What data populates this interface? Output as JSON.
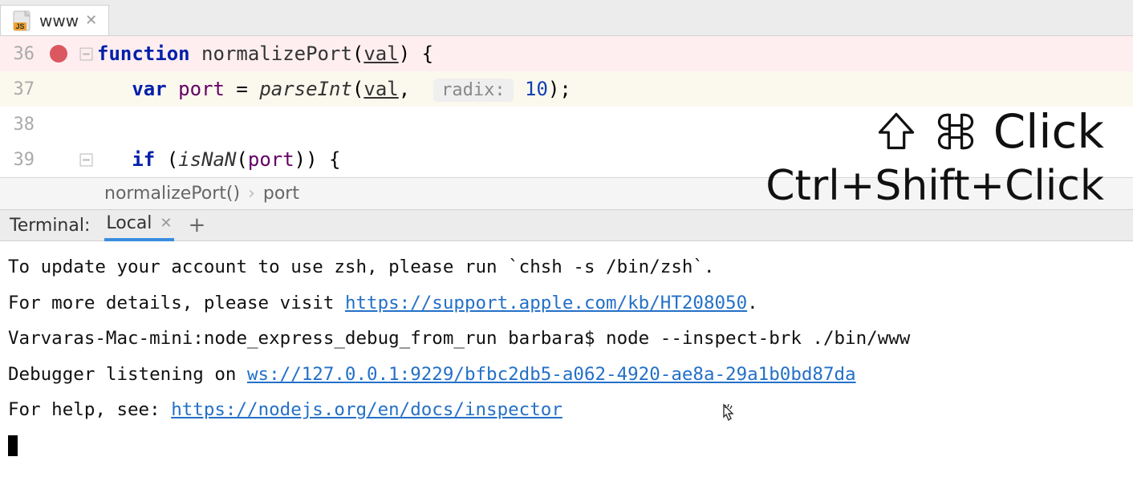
{
  "tab": {
    "filename": "www"
  },
  "code": {
    "lines": [
      36,
      37,
      38,
      39
    ],
    "l36": {
      "kw": "function",
      "fn": "normalizePort",
      "param": "val",
      "tail": ") {"
    },
    "l37": {
      "kw": "var",
      "varname": "port",
      "eq": " = ",
      "call": "parseInt",
      "open": "(",
      "param": "val",
      "comma": ",",
      "hint": "radix:",
      "num": "10",
      "tail": ");"
    },
    "l39": {
      "kw": "if",
      "open": " (",
      "call": "isNaN",
      "popen": "(",
      "var": "port",
      "tail": ")) {"
    }
  },
  "overlay": {
    "mac": "Click",
    "other": "Ctrl+Shift+Click"
  },
  "breadcrumb": {
    "fn": "normalizePort()",
    "var": "port"
  },
  "terminal": {
    "label": "Terminal:",
    "tab": "Local",
    "lines": {
      "l1a": "To update your account to use zsh, please run `chsh -s /bin/zsh`.",
      "l2a": "For more details, please visit ",
      "l2link": "https://support.apple.com/kb/HT208050",
      "l2b": ".",
      "l3": "Varvaras-Mac-mini:node_express_debug_from_run barbara$ node --inspect-brk ./bin/www",
      "l4a": "Debugger listening on ",
      "l4link": "ws://127.0.0.1:9229/bfbc2db5-a062-4920-ae8a-29a1b0bd87da",
      "l5a": "For help, see: ",
      "l5link": "https://nodejs.org/en/docs/inspector"
    }
  }
}
